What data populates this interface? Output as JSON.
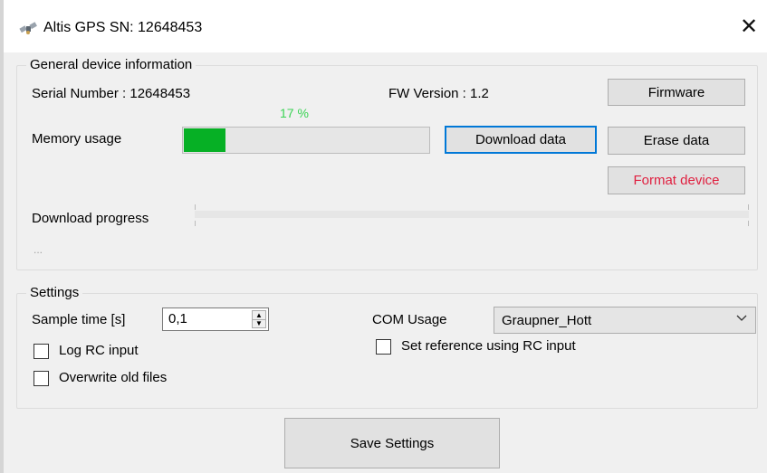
{
  "window": {
    "title": "Altis GPS  SN: 12648453",
    "close_label": "✕",
    "app_icon": "satellite-icon"
  },
  "general_group": {
    "title": "General device information",
    "serial_label": "Serial Number :  12648453",
    "fw_label": "FW Version :  1.2",
    "firmware_button": "Firmware",
    "memory_label": "Memory usage",
    "memory_percent_text": "17 %",
    "memory_percent_value": 17,
    "memory_percent_color": "#39d353",
    "memory_bar_color": "#06b025",
    "download_button": "Download data",
    "erase_button": "Erase data",
    "format_button": "Format device",
    "format_button_color": "#e02040",
    "download_progress_label": "Download progress",
    "download_progress_value": 0,
    "status_text": "..."
  },
  "settings_group": {
    "title": "Settings",
    "sample_time_label": "Sample time [s]",
    "sample_time_value": "0,1",
    "com_usage_label": "COM Usage",
    "com_usage_value": "Graupner_Hott",
    "log_rc_label": "Log RC input",
    "log_rc_checked": false,
    "set_reference_label": "Set reference using RC input",
    "set_reference_checked": false,
    "overwrite_label": "Overwrite old files",
    "overwrite_checked": false
  },
  "save_button": "Save Settings"
}
